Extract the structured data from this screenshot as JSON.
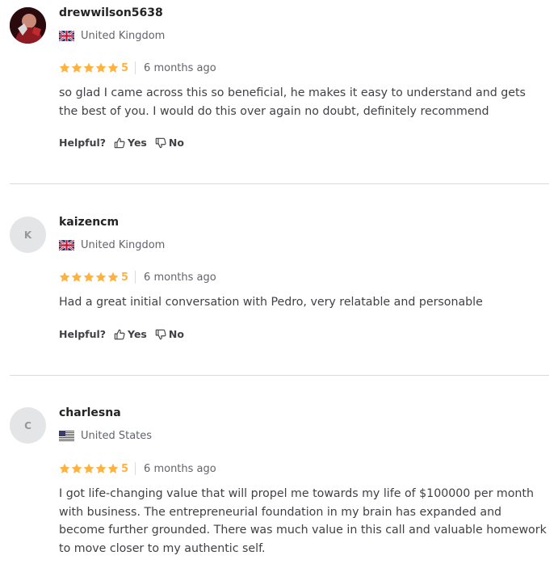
{
  "reviews": [
    {
      "username": "drewwilson5638",
      "avatar": {
        "type": "photo",
        "initial": ""
      },
      "country": "United Kingdom",
      "flag": "uk-flag-icon",
      "rating": "5",
      "time": "6 months ago",
      "text": "so glad I came across this so beneficial, he makes it easy to understand and gets the best of you. I would do this over again no doubt, definitely recommend",
      "helpful": {
        "label": "Helpful?",
        "yes": "Yes",
        "no": "No"
      }
    },
    {
      "username": "kaizencm",
      "avatar": {
        "type": "initial",
        "initial": "K"
      },
      "country": "United Kingdom",
      "flag": "uk-flag-icon",
      "rating": "5",
      "time": "6 months ago",
      "text": "Had a great initial conversation with Pedro, very relatable and personable",
      "helpful": {
        "label": "Helpful?",
        "yes": "Yes",
        "no": "No"
      }
    },
    {
      "username": "charlesna",
      "avatar": {
        "type": "initial",
        "initial": "C"
      },
      "country": "United States",
      "flag": "us-flag-icon",
      "rating": "5",
      "time": "6 months ago",
      "text": "I got life-changing value that will propel me towards my life of $100000 per month with business. The entrepreneurial foundation in my brain has expanded and become further grounded. There was much value in this call and valuable homework to move closer to my authentic self.",
      "helpful": null
    }
  ],
  "colors": {
    "star": "#ffb33e",
    "divider": "#dadbdd",
    "text": "#404145",
    "muted": "#62646a"
  }
}
